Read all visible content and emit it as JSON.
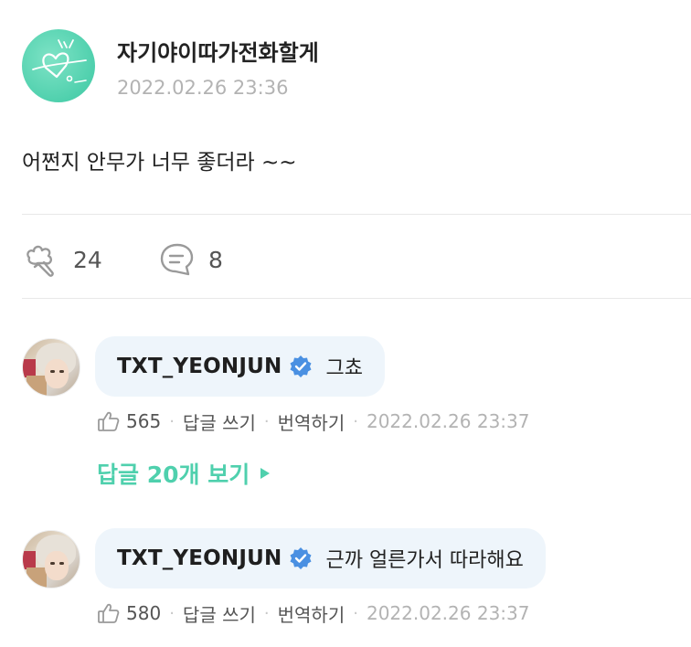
{
  "post": {
    "author": "자기야이따가전화할게",
    "timestamp": "2022.02.26 23:36",
    "body": "어쩐지 안무가 너무 좋더라 ~~",
    "like_count": "24",
    "comment_count": "8"
  },
  "comments": [
    {
      "username": "TXT_YEONJUN",
      "text": "그쵸",
      "likes": "565",
      "reply_label": "답글 쓰기",
      "translate_label": "번역하기",
      "timestamp": "2022.02.26 23:37"
    },
    {
      "username": "TXT_YEONJUN",
      "text": "근까 얼른가서 따라해요",
      "likes": "580",
      "reply_label": "답글 쓰기",
      "translate_label": "번역하기",
      "timestamp": "2022.02.26 23:37"
    }
  ],
  "view_replies_label": "답글 20개 보기",
  "colors": {
    "accent": "#4fd0ad",
    "verified": "#4a90e2",
    "bubble_bg": "#eef5fb",
    "muted": "#b3b3b3"
  },
  "icons": {
    "like": "bouquet-like-icon",
    "comment": "speech-bubble-icon",
    "verified": "verified-badge-icon",
    "thumb": "thumbs-up-icon",
    "expand": "triangle-right-icon"
  }
}
